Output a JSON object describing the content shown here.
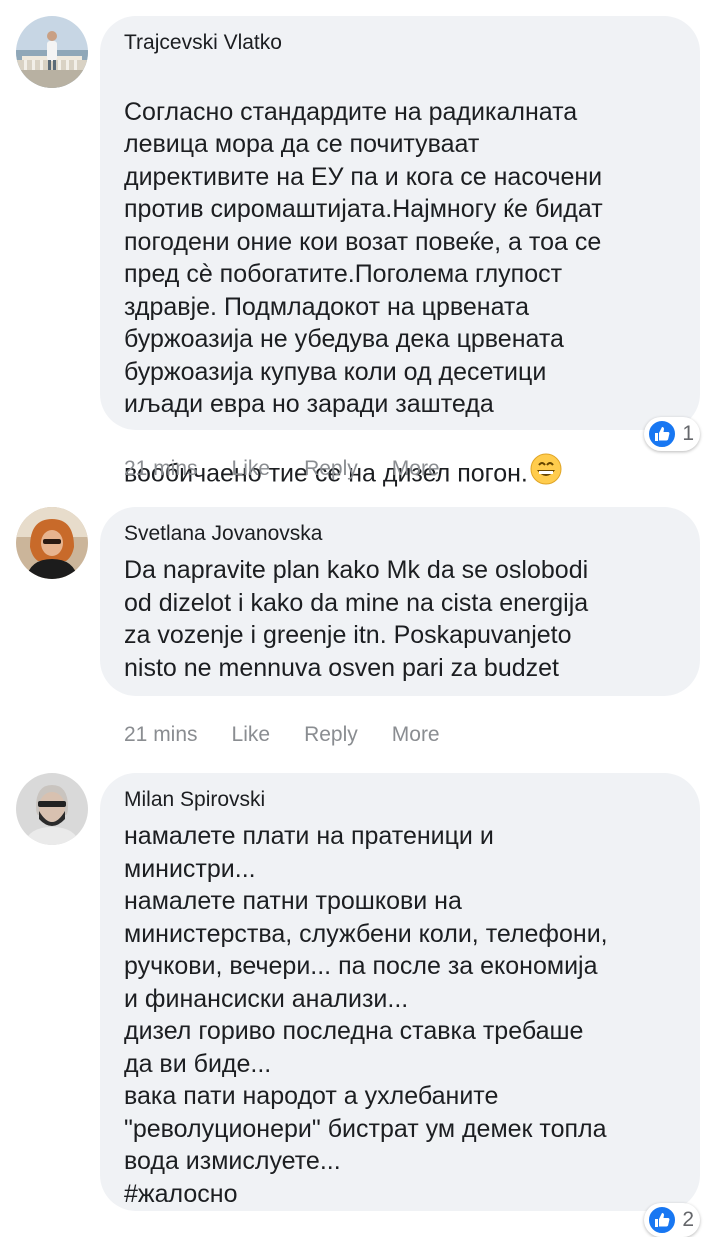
{
  "comments": [
    {
      "author": "Trajcevski Vlatko",
      "text": "Согласно стандардите на радикалната\nлевица мора да се почитуваат\nдирективите на ЕУ па и кога се насочени\nпротив сиромаштијата.Најмногу ќе бидат\nпогодени оние кои возат повеќе, а тоа се\nпред сè побогатите.Поголема глупост\nздравје. Подмладокот на црвената\nбуржоазија не убедува дека црвената\nбуржоазија купува коли од десетици\nиљади евра но заради заштеда\nвообичаено тие се на дизел погон.",
      "emoji": "grinning-face-emoji",
      "reaction_count": "1",
      "time": "21 mins",
      "like_label": "Like",
      "reply_label": "Reply",
      "more_label": "More"
    },
    {
      "author": "Svetlana Jovanovska",
      "text": "Da napravite plan kako Mk da se oslobodi\nod dizelot i kako da mine na cista energija\nza vozenje i greenje itn. Poskapuvanjeto\nnisto ne mennuva osven pari za budzet",
      "time": "21 mins",
      "like_label": "Like",
      "reply_label": "Reply",
      "more_label": "More"
    },
    {
      "author": "Milan Spirovski",
      "text": "намалете плати на пратеници и\nминистри...\nнамалете патни трошкови на\nминистерства, службени коли, телефони,\nручкови, вечери... па после за економија\nи финансиски анализи...\nдизел гориво последна ставка требаше\nда ви биде...\nвака пати народот а ухлебаните\n\"револуционери\" бистрат ум демек топла\nвода измислуете...\n#жалосно",
      "reaction_count": "2"
    }
  ],
  "colors": {
    "bubble": "#f0f2f5",
    "like_blue": "#1877f2",
    "meta_gray": "#8a8d91"
  }
}
